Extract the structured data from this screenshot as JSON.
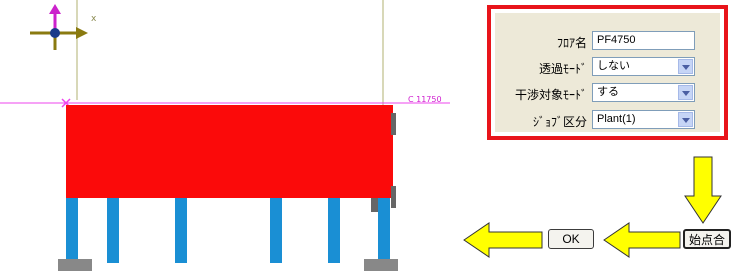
{
  "canvas": {
    "axis_x_label": "x",
    "level_label": "C 11750",
    "colors": {
      "slab": "#fb0a0a",
      "pillar": "#1a8fd4",
      "base": "#888888",
      "guide": "#b0b070",
      "level": "#ee44ee"
    }
  },
  "panel": {
    "rows": [
      {
        "label": "ﾌﾛｱ名",
        "value": "PF4750",
        "kind": "text"
      },
      {
        "label": "透過ﾓｰﾄﾞ",
        "value": "しない",
        "kind": "select"
      },
      {
        "label": "干渉対象ﾓｰﾄﾞ",
        "value": "する",
        "kind": "select"
      },
      {
        "label": "ｼﾞｮﾌﾞ区分",
        "value": "Plant(1)",
        "kind": "select"
      }
    ]
  },
  "buttons": {
    "ok": "OK",
    "start_point": "始点合"
  },
  "arrow_color": "#ffff00"
}
